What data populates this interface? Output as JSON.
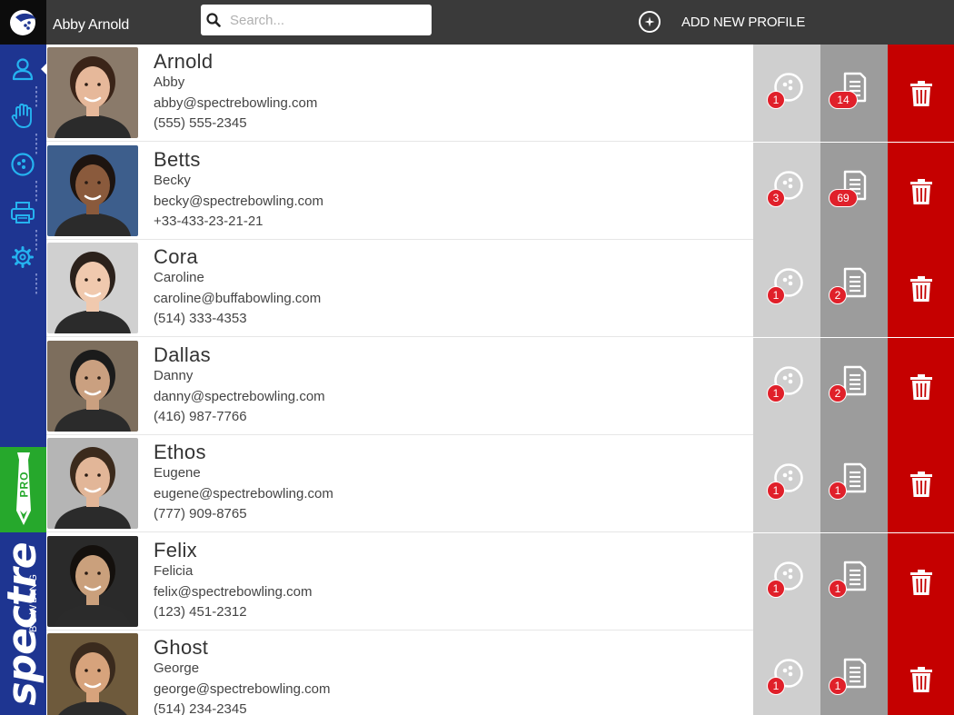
{
  "header": {
    "user_name": "Abby Arnold",
    "search_placeholder": "Search...",
    "add_profile_label": "ADD NEW PROFILE"
  },
  "sidebar": {
    "items": [
      {
        "icon": "user-icon",
        "active": true
      },
      {
        "icon": "hand-icon",
        "active": false
      },
      {
        "icon": "bowling-ball-icon",
        "active": false
      },
      {
        "icon": "printer-icon",
        "active": false
      },
      {
        "icon": "gear-icon",
        "active": false
      }
    ],
    "pro_badge": "PRO",
    "brand_name": "spectre",
    "brand_sub": "BOWLING"
  },
  "colors": {
    "topbar": "#3a3a3a",
    "sidebar": "#1e3591",
    "pro_green": "#26a82c",
    "ball_column": "#cfcfcf",
    "doc_column": "#9c9c9c",
    "delete_column": "#c50000",
    "badge": "#e0202a"
  },
  "profiles": [
    {
      "last": "Arnold",
      "first": "Abby",
      "email": "abby@spectrebowling.com",
      "phone": "(555) 555-2345",
      "balls": "1",
      "docs": "14"
    },
    {
      "last": "Betts",
      "first": "Becky",
      "email": "becky@spectrebowling.com",
      "phone": "+33-433-23-21-21",
      "balls": "3",
      "docs": "69"
    },
    {
      "last": "Cora",
      "first": "Caroline",
      "email": "caroline@buffabowling.com",
      "phone": "(514) 333-4353",
      "balls": "1",
      "docs": "2"
    },
    {
      "last": "Dallas",
      "first": "Danny",
      "email": "danny@spectrebowling.com",
      "phone": "(416) 987-7766",
      "balls": "1",
      "docs": "2"
    },
    {
      "last": "Ethos",
      "first": "Eugene",
      "email": "eugene@spectrebowling.com",
      "phone": "(777) 909-8765",
      "balls": "1",
      "docs": "1"
    },
    {
      "last": "Felix",
      "first": "Felicia",
      "email": "felix@spectrebowling.com",
      "phone": "(123) 451-2312",
      "balls": "1",
      "docs": "1"
    },
    {
      "last": "Ghost",
      "first": "George",
      "email": "george@spectrebowling.com",
      "phone": "(514) 234-2345",
      "balls": "1",
      "docs": "1"
    }
  ]
}
